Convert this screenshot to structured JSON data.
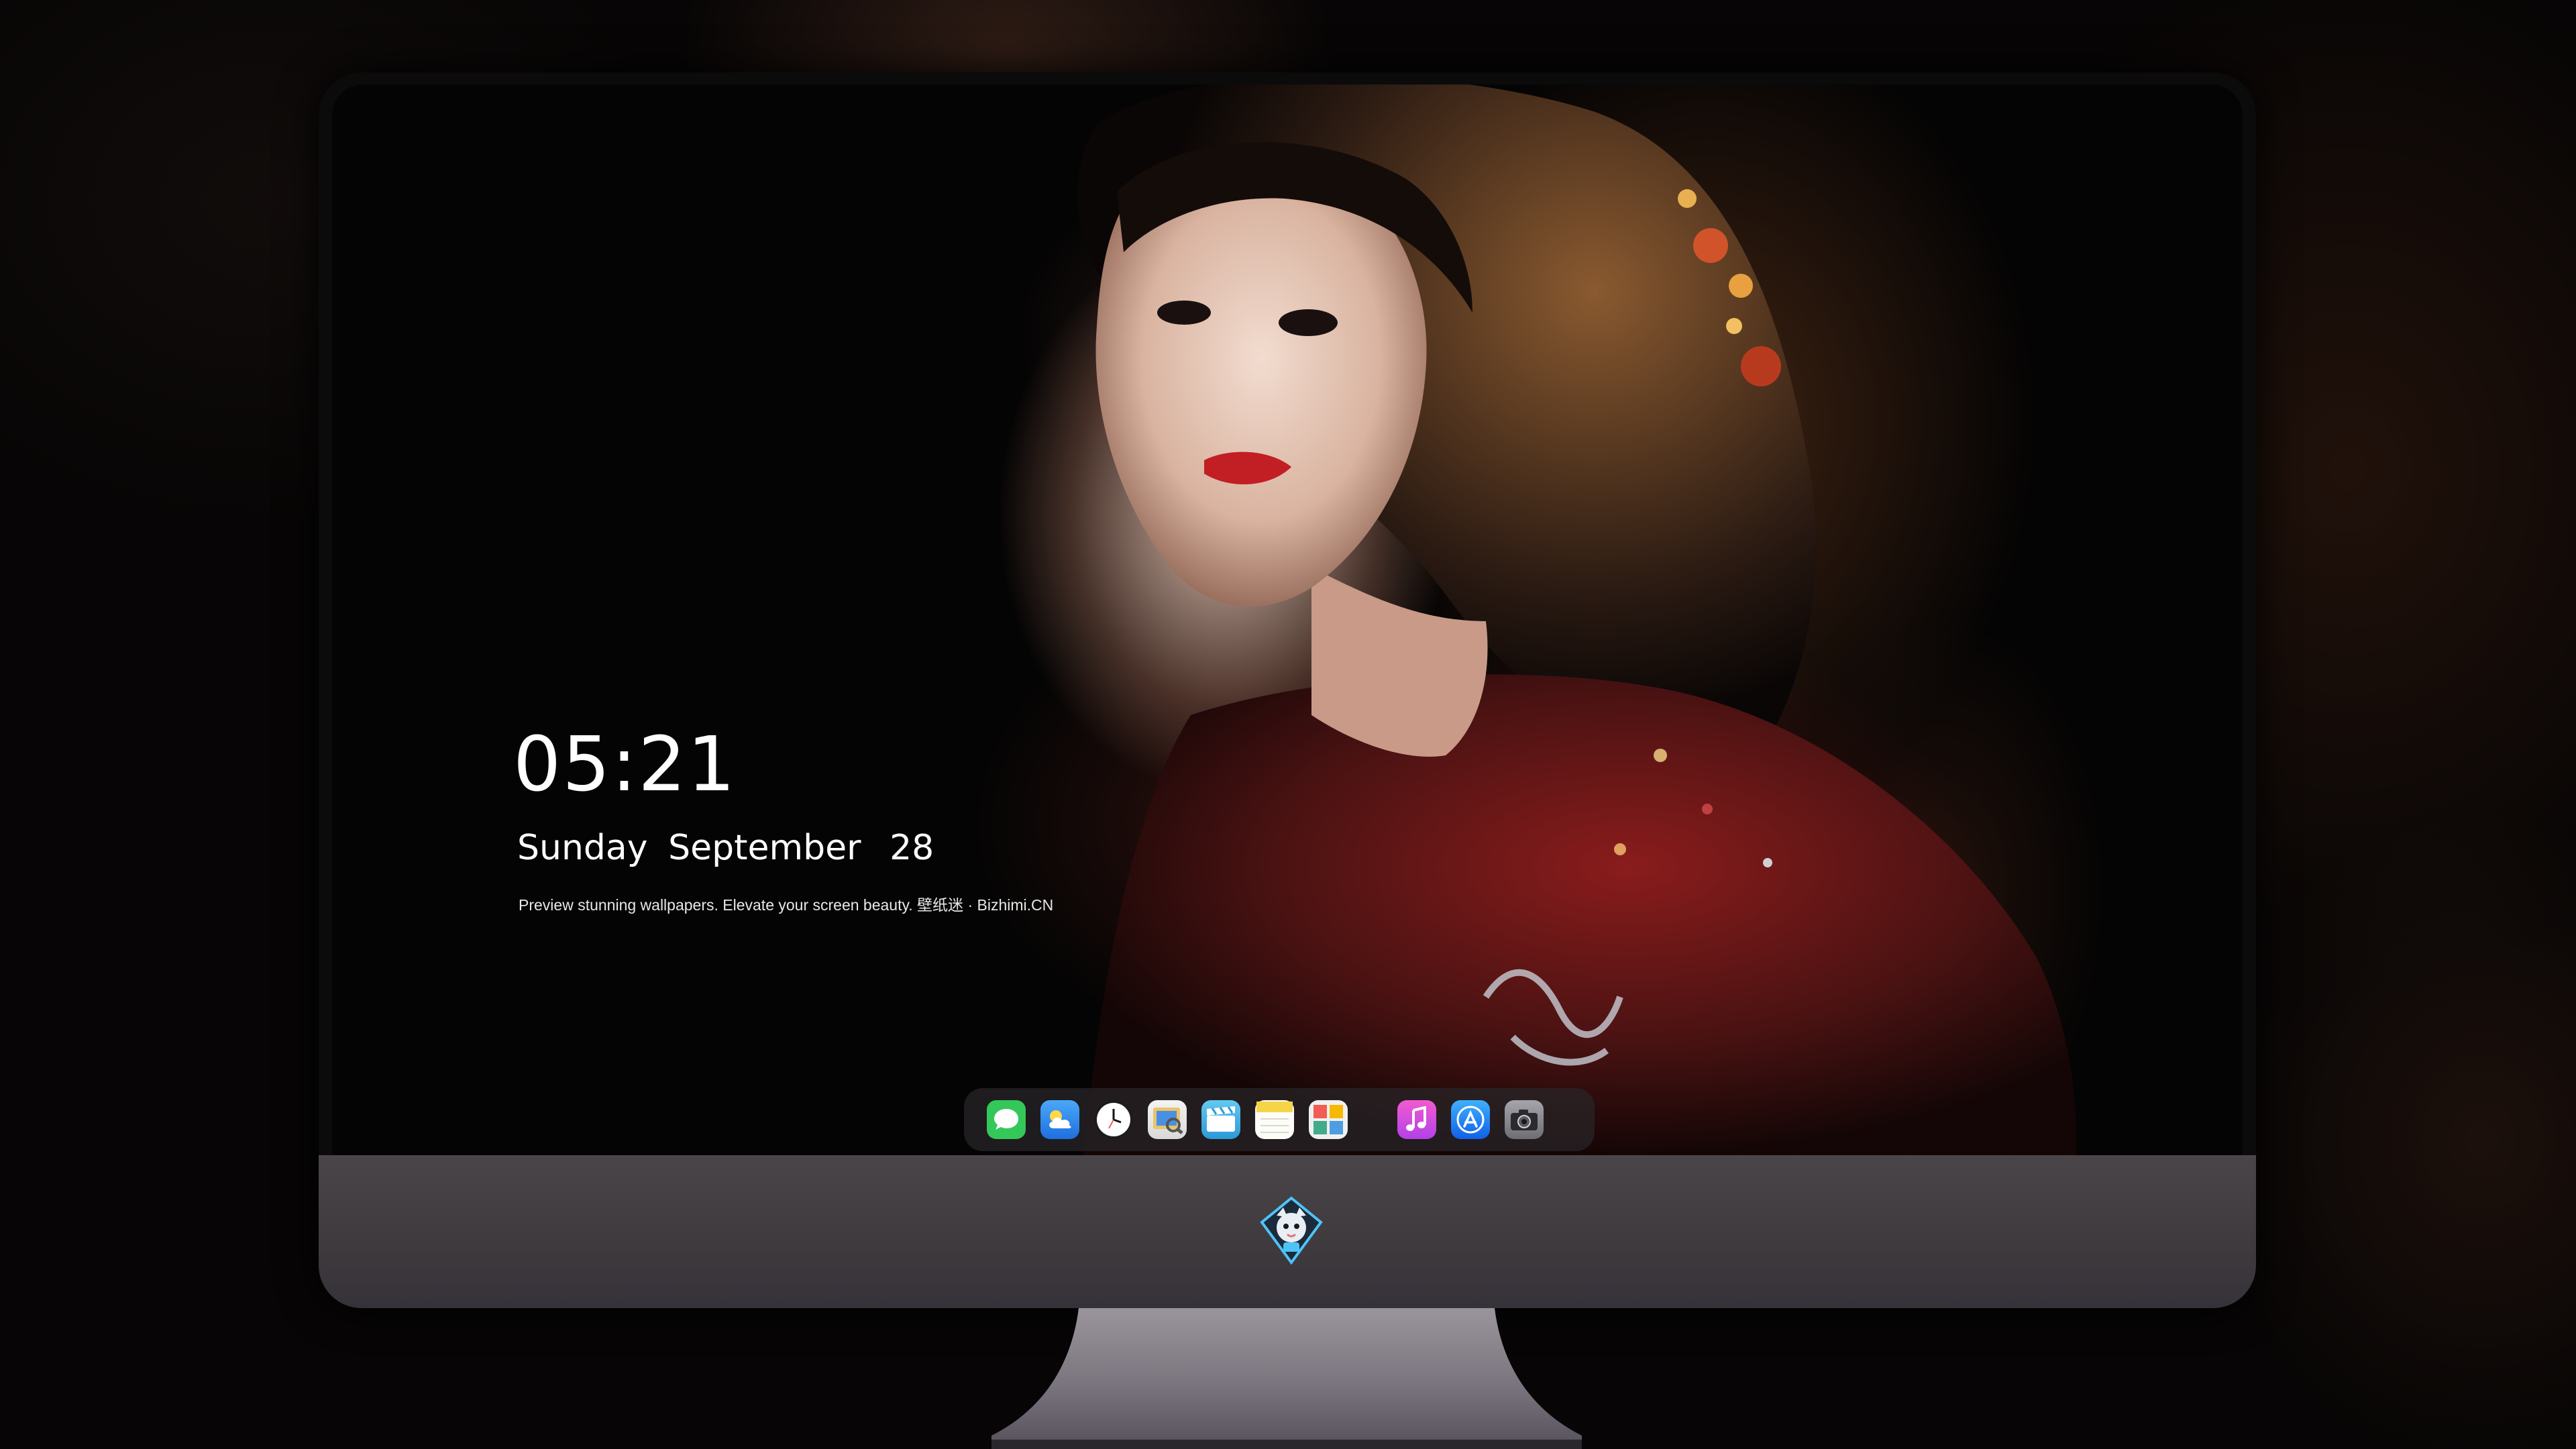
{
  "lockscreen": {
    "time": "05:21",
    "date": {
      "weekday": "Sunday",
      "month": "September",
      "day": "28"
    },
    "tagline": "Preview stunning wallpapers. Elevate your screen beauty. 壁纸迷 · Bizhimi.CN"
  },
  "dock": {
    "apps": [
      {
        "icon": "messages-icon",
        "color": "#34c759"
      },
      {
        "icon": "weather-icon",
        "color": "#2f8ef0"
      },
      {
        "icon": "clock-icon",
        "color": "#ffffff"
      },
      {
        "icon": "preview-icon",
        "color": "#e9c46a"
      },
      {
        "icon": "clips-icon",
        "color": "#45b7e8"
      },
      {
        "icon": "notes-icon",
        "color": "#f5d547"
      },
      {
        "icon": "photo-gallery-icon",
        "color": "#f0f0f0"
      },
      {
        "icon": "itunes-icon",
        "color": "#e040c8"
      },
      {
        "icon": "app-store-icon",
        "color": "#1c8ef9"
      },
      {
        "icon": "camera-icon",
        "color": "#8e8e93"
      }
    ]
  },
  "monitor": {
    "chin_logo": "mascot-logo-icon",
    "bezel_color": "#0c0b0b",
    "chin_color": "#46424a"
  }
}
